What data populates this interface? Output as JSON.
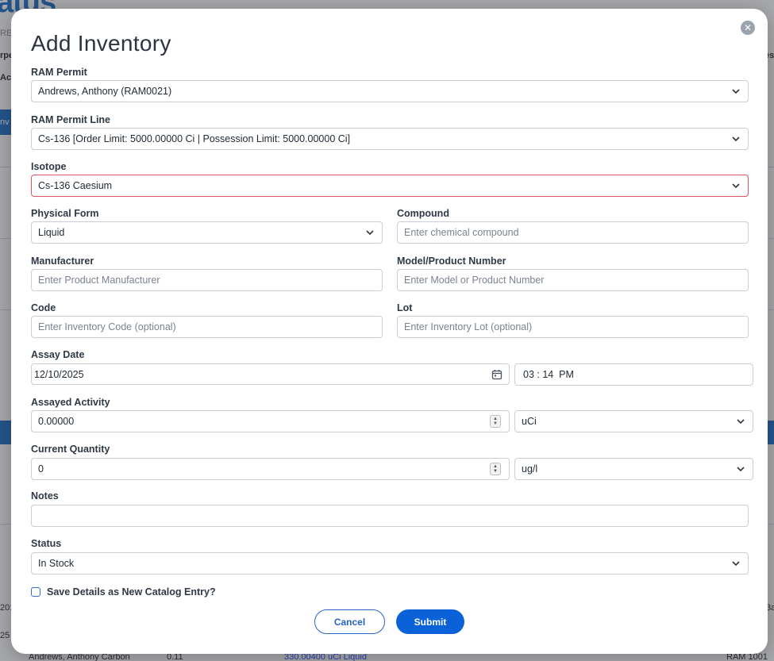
{
  "modal": {
    "title": "Add Inventory",
    "close_icon": "close-icon"
  },
  "fields": {
    "ram_permit": {
      "label": "RAM Permit",
      "value": "Andrews, Anthony (RAM0021)"
    },
    "ram_permit_line": {
      "label": "RAM Permit Line",
      "value": "Cs-136 [Order Limit: 5000.00000 Ci | Possession Limit: 5000.00000 Ci]"
    },
    "isotope": {
      "label": "Isotope",
      "value": "Cs-136 Caesium"
    },
    "physical_form": {
      "label": "Physical Form",
      "value": "Liquid"
    },
    "compound": {
      "label": "Compound",
      "placeholder": "Enter chemical compound"
    },
    "manufacturer": {
      "label": "Manufacturer",
      "placeholder": "Enter Product Manufacturer"
    },
    "model_number": {
      "label": "Model/Product Number",
      "placeholder": "Enter Model or Product Number"
    },
    "code": {
      "label": "Code",
      "placeholder": "Enter Inventory Code (optional)"
    },
    "lot": {
      "label": "Lot",
      "placeholder": "Enter Inventory Lot (optional)"
    },
    "assay_date": {
      "label": "Assay Date",
      "date_value": "12/10/2025",
      "time_value": "03 : 14  PM"
    },
    "assayed_activity": {
      "label": "Assayed Activity",
      "value": "0.00000",
      "unit": "uCi"
    },
    "current_quantity": {
      "label": "Current Quantity",
      "value": "0",
      "unit": "ug/l"
    },
    "notes": {
      "label": "Notes",
      "value": ""
    },
    "status": {
      "label": "Status",
      "value": "In Stock"
    }
  },
  "save_catalog": {
    "label": "Save Details as New Catalog Entry?",
    "checked": false
  },
  "buttons": {
    "cancel": "Cancel",
    "submit": "Submit"
  },
  "background": {
    "logo": "atus",
    "fragments": [
      "RE",
      "rpe",
      "Ac",
      "nv",
      "201",
      "25",
      "es",
      "3a",
      "RAM 1001",
      "Andrews, Anthony  Carbon",
      "330.00400 uCi  Liquid",
      "0.11"
    ]
  },
  "colors": {
    "accent": "#0b61d8",
    "error_border": "#e05561",
    "brand": "#1565c0"
  }
}
